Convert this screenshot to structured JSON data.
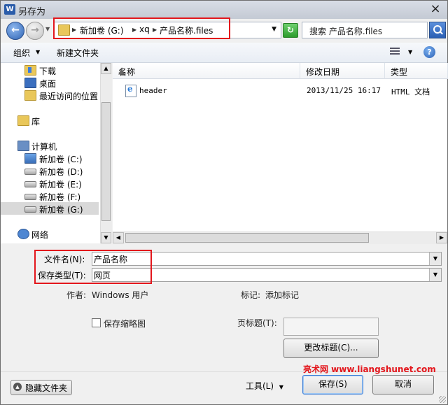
{
  "window": {
    "app_icon": "W",
    "title": "另存为",
    "close_glyph": "×"
  },
  "address": {
    "crumbs": [
      "新加卷 (G:)",
      "xq",
      "产品名称.files"
    ],
    "search_placeholder": "搜索 产品名称.files"
  },
  "toolbar": {
    "organize": "组织",
    "new_folder": "新建文件夹",
    "help": "?"
  },
  "nav_pane": {
    "items": [
      {
        "label": "下载",
        "icon": "download-folder-icon"
      },
      {
        "label": "桌面",
        "icon": "desktop-icon"
      },
      {
        "label": "最近访问的位置",
        "icon": "recent-places-icon"
      },
      {
        "label": "库",
        "icon": "library-icon"
      },
      {
        "label": "计算机",
        "icon": "computer-icon"
      },
      {
        "label": "新加卷 (C:)",
        "icon": "system-drive-icon"
      },
      {
        "label": "新加卷 (D:)",
        "icon": "drive-icon"
      },
      {
        "label": "新加卷 (E:)",
        "icon": "drive-icon"
      },
      {
        "label": "新加卷 (F:)",
        "icon": "drive-icon"
      },
      {
        "label": "新加卷 (G:)",
        "icon": "drive-icon",
        "selected": true
      },
      {
        "label": "网络",
        "icon": "network-icon"
      }
    ]
  },
  "file_list": {
    "columns": [
      "名称",
      "修改日期",
      "类型"
    ],
    "rows": [
      {
        "name": "header",
        "modified": "2013/11/25 16:17",
        "type": "HTML 文档",
        "icon": "html-file-icon"
      }
    ]
  },
  "form": {
    "filename_label": "文件名(N):",
    "filename_value": "产品名称",
    "filetype_label": "保存类型(T):",
    "filetype_value": "网页",
    "author_label": "作者:",
    "author_value": "Windows 用户",
    "tags_label": "标记:",
    "tags_value": "添加标记",
    "save_thumbnail": "保存缩略图",
    "page_title_label": "页标题(T):",
    "page_title_value": "",
    "change_title_button": "更改标题(C)..."
  },
  "footer": {
    "hide_folders": "隐藏文件夹",
    "tools": "工具(L)",
    "save": "保存(S)",
    "cancel": "取消",
    "watermark": "亮术网 www.liangshunet.com"
  },
  "colors": {
    "highlight_red": "#e3161c",
    "accent_blue": "#2a5fb4"
  }
}
